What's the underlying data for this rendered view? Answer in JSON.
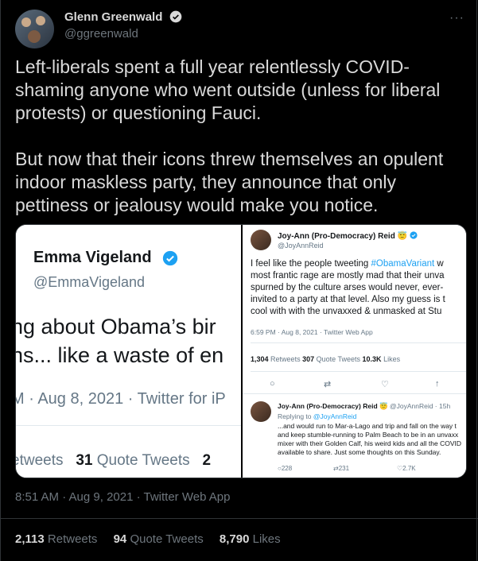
{
  "author": {
    "name": "Glenn Greenwald",
    "handle": "@ggreenwald"
  },
  "more_label": "···",
  "tweet_text": "Left-liberals spent a full year relentlessly COVID-shaming anyone who went outside (unless for liberal protests) or questioning Fauci.\n\nBut now that their icons threw themselves an opulent indoor maskless party, they announce that only pettiness or jealousy would make you notice.",
  "media": {
    "left": {
      "name": "Emma Vigeland",
      "handle": "@EmmaVigeland",
      "text": "ng about Obama’s bir\nns... like a waste of en",
      "meta": "M · Aug 8, 2021 · Twitter for iP",
      "stats_retweets_fragment": "etweets",
      "stats_quote_count": "31",
      "stats_quote_label": "Quote Tweets",
      "stats_tail": "2"
    },
    "right": {
      "name": "Joy-Ann (Pro-Democracy) Reid 😇",
      "handle": "@JoyAnnReid",
      "text_before": "I feel like the people tweeting ",
      "hashtag": "#ObamaVariant",
      "text_line1_after": " w",
      "text_rest": "most frantic rage are mostly mad that their unva\nspurned by the culture arses would never, ever-\ninvited to a party at that level. Also my guess is t\ncool with with the unvaxxed & unmasked at Stu",
      "meta": "6:59 PM · Aug 8, 2021 · Twitter Web App",
      "retweets_count": "1,304",
      "retweets_label": "Retweets",
      "quotes_count": "307",
      "quotes_label": "Quote Tweets",
      "likes_count": "10.3K",
      "likes_label": "Likes",
      "reply": {
        "name": "Joy-Ann (Pro-Democracy) Reid 😇",
        "meta": "@JoyAnnReid · 15h",
        "replying_label": "Replying to",
        "replying_to": "@JoyAnnReid",
        "text": "...and would run to Mar-a-Lago and trip and fall on the way t\nand keep stumble-running to Palm Beach to be in an unvaxx\nmixer with their Golden Calf, his weird kids and all the COVID\navailable to share. Just some thoughts on this Sunday.",
        "replies": "228",
        "retweets": "231",
        "likes": "2.7K"
      }
    }
  },
  "timestamp": "8:51 AM · Aug 9, 2021 · Twitter Web App",
  "stats": {
    "retweets_count": "2,113",
    "retweets_label": "Retweets",
    "quotes_count": "94",
    "quotes_label": "Quote Tweets",
    "likes_count": "8,790",
    "likes_label": "Likes"
  },
  "colors": {
    "background": "#000000",
    "text": "#d9d9d9",
    "secondary": "#6e767d",
    "link": "#1da1f2",
    "verified": "#1da1f2"
  }
}
